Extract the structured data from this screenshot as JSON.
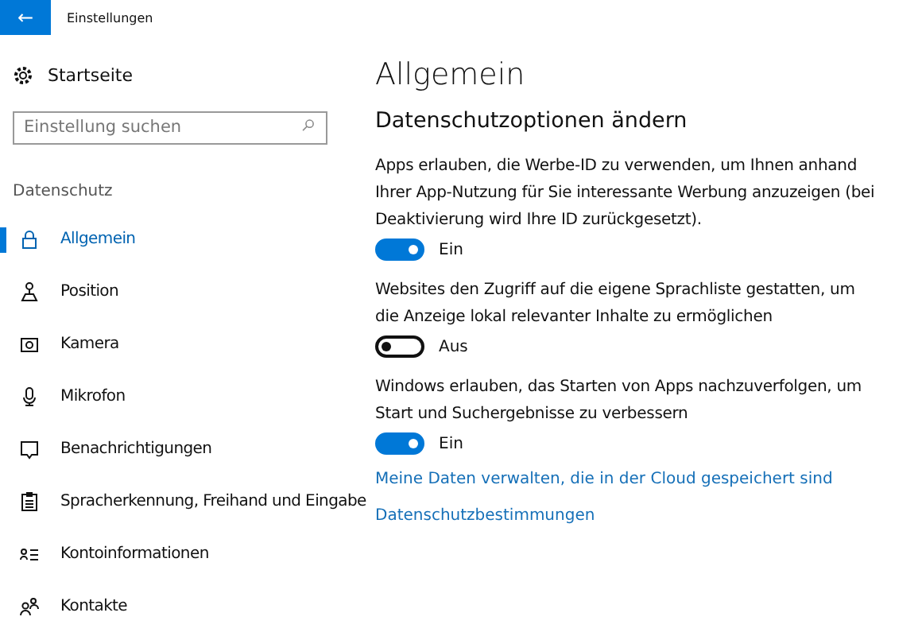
{
  "window": {
    "title": "Einstellungen",
    "back": "←"
  },
  "sidebar": {
    "home": "Startseite",
    "search": {
      "placeholder": "Einstellung suchen"
    },
    "section": "Datenschutz",
    "items": [
      {
        "label": "Allgemein",
        "selected": true
      },
      {
        "label": "Position",
        "selected": false
      },
      {
        "label": "Kamera",
        "selected": false
      },
      {
        "label": "Mikrofon",
        "selected": false
      },
      {
        "label": "Benachrichtigungen",
        "selected": false
      },
      {
        "label": "Spracherkennung, Freihand und Eingabe",
        "selected": false
      },
      {
        "label": "Kontoinformationen",
        "selected": false
      },
      {
        "label": "Kontakte",
        "selected": false
      }
    ]
  },
  "content": {
    "title": "Allgemein",
    "subtitle": "Datenschutzoptionen ändern",
    "options": [
      {
        "text": "Apps erlauben, die Werbe-ID zu verwenden, um Ihnen anhand Ihrer App-Nutzung für Sie interessante Werbung anzuzeigen (bei Deaktivierung wird Ihre ID zurückgesetzt).",
        "on": true,
        "state": "Ein"
      },
      {
        "text": "Websites den Zugriff auf die eigene Sprachliste gestatten, um die Anzeige lokal relevanter Inhalte zu ermöglichen",
        "on": false,
        "state": "Aus"
      },
      {
        "text": "Windows erlauben, das Starten von Apps nachzuverfolgen, um Start und Suchergebnisse zu verbessern",
        "on": true,
        "state": "Ein"
      }
    ],
    "links": [
      "Meine Daten verwalten, die in der Cloud gespeichert sind",
      "Datenschutzbestimmungen"
    ]
  }
}
